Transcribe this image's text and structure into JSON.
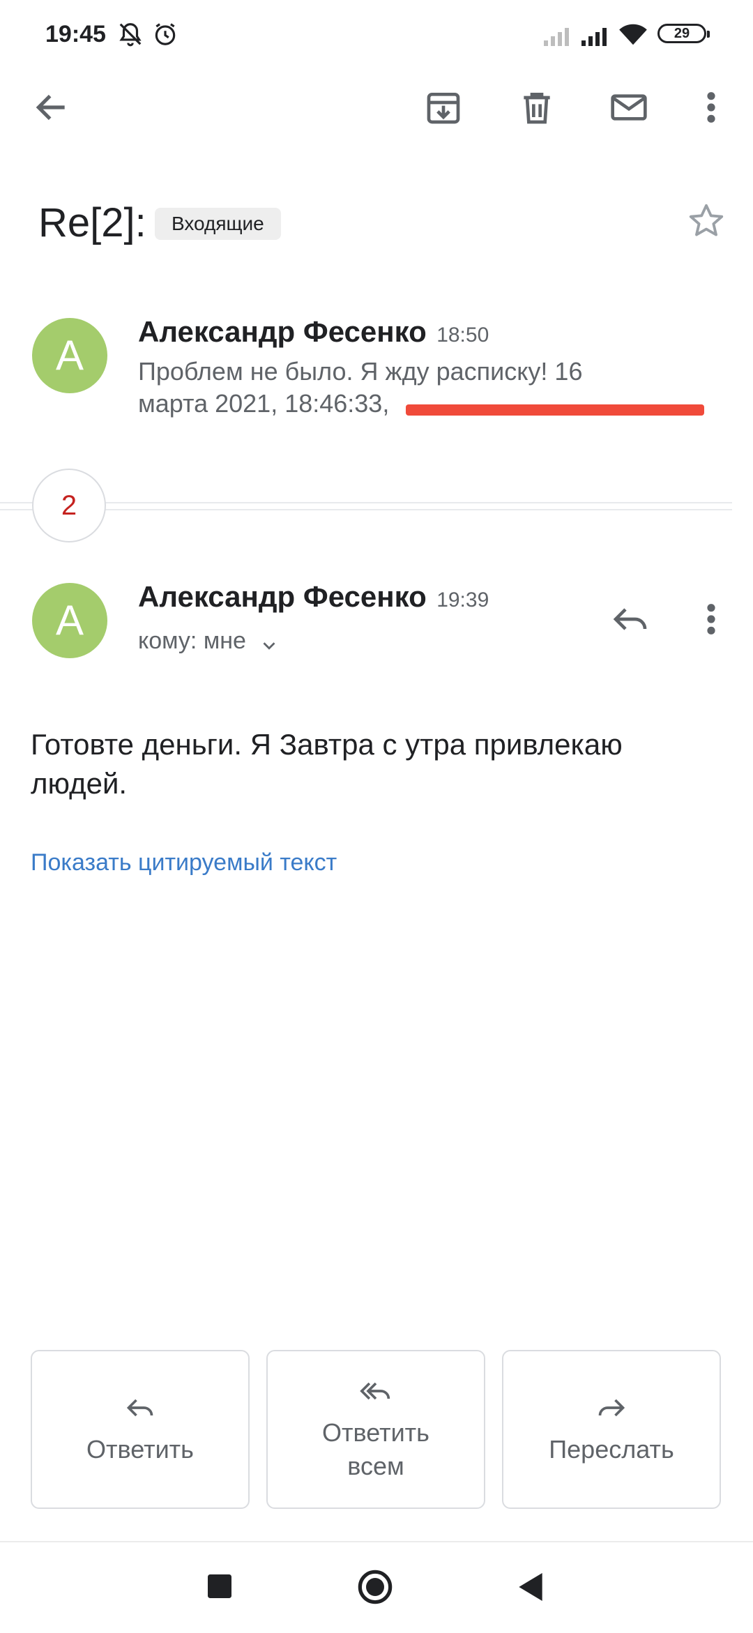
{
  "status_bar": {
    "time": "19:45",
    "battery": "29"
  },
  "toolbar": {
    "back": "back-arrow-icon",
    "archive": "archive-icon",
    "delete": "trash-icon",
    "mark_unread": "mail-icon",
    "more": "more-vert-icon"
  },
  "thread": {
    "subject": "Re[2]:",
    "label": "Входящие",
    "collapsed_count": "2",
    "messages": [
      {
        "avatar_letter": "А",
        "sender": "Александр Фесенко",
        "time": "18:50",
        "snippet_line1": "Проблем не было. Я жду расписку! 16",
        "snippet_line2": "марта 2021, 18:46:33,"
      },
      {
        "avatar_letter": "А",
        "sender": "Александр Фесенко",
        "time": "19:39",
        "recipient": "кому: мне",
        "body": "Готовте деньги. Я Завтра с утра привлекаю людей.",
        "show_quoted": "Показать цитируемый текст"
      }
    ]
  },
  "actions": {
    "reply": "Ответить",
    "reply_all": "Ответить всем",
    "forward": "Переслать"
  },
  "colors": {
    "avatar": "#a4cc6c",
    "link": "#3a7bc8",
    "redaction": "#f04a3a",
    "count": "#c5221f"
  }
}
